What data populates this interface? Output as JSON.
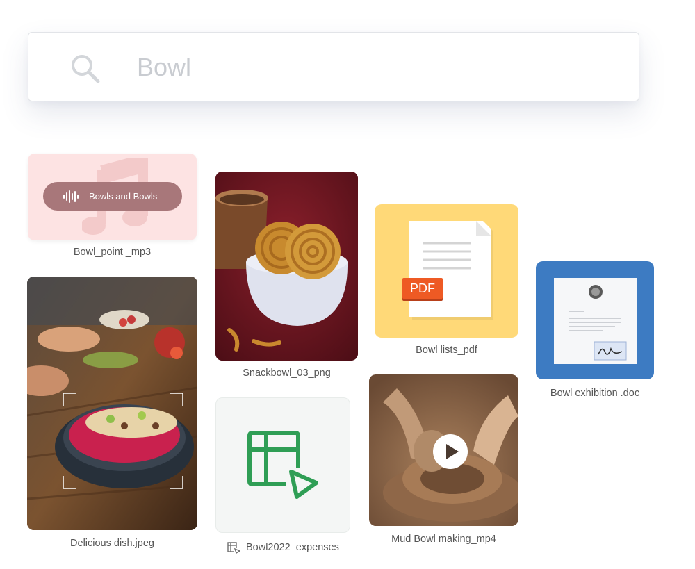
{
  "search": {
    "value": "Bowl",
    "icon": "search-icon"
  },
  "files": {
    "mp3": {
      "caption": "Bowl_point _mp3",
      "track": "Bowls and Bowls",
      "icon": "music-note-icon"
    },
    "snack": {
      "caption": "Snackbowl_03_png"
    },
    "pdf": {
      "caption": "Bowl lists_pdf",
      "badge": "PDF"
    },
    "doc": {
      "caption": "Bowl exhibition .doc"
    },
    "dish": {
      "caption": "Delicious dish.jpeg"
    },
    "sheet": {
      "caption": "Bowl2022_expenses",
      "icon": "spreadsheet-icon"
    },
    "video": {
      "caption": "Mud Bowl making_mp4",
      "icon": "play-icon"
    }
  },
  "colors": {
    "mp3_bg": "#fde3e3",
    "mp3_pill": "#a8777a",
    "pdf_bg": "#ffd978",
    "pdf_badge": "#ee5a24",
    "doc_bg": "#3d7bc2",
    "sheet_icon": "#2f9e55"
  }
}
